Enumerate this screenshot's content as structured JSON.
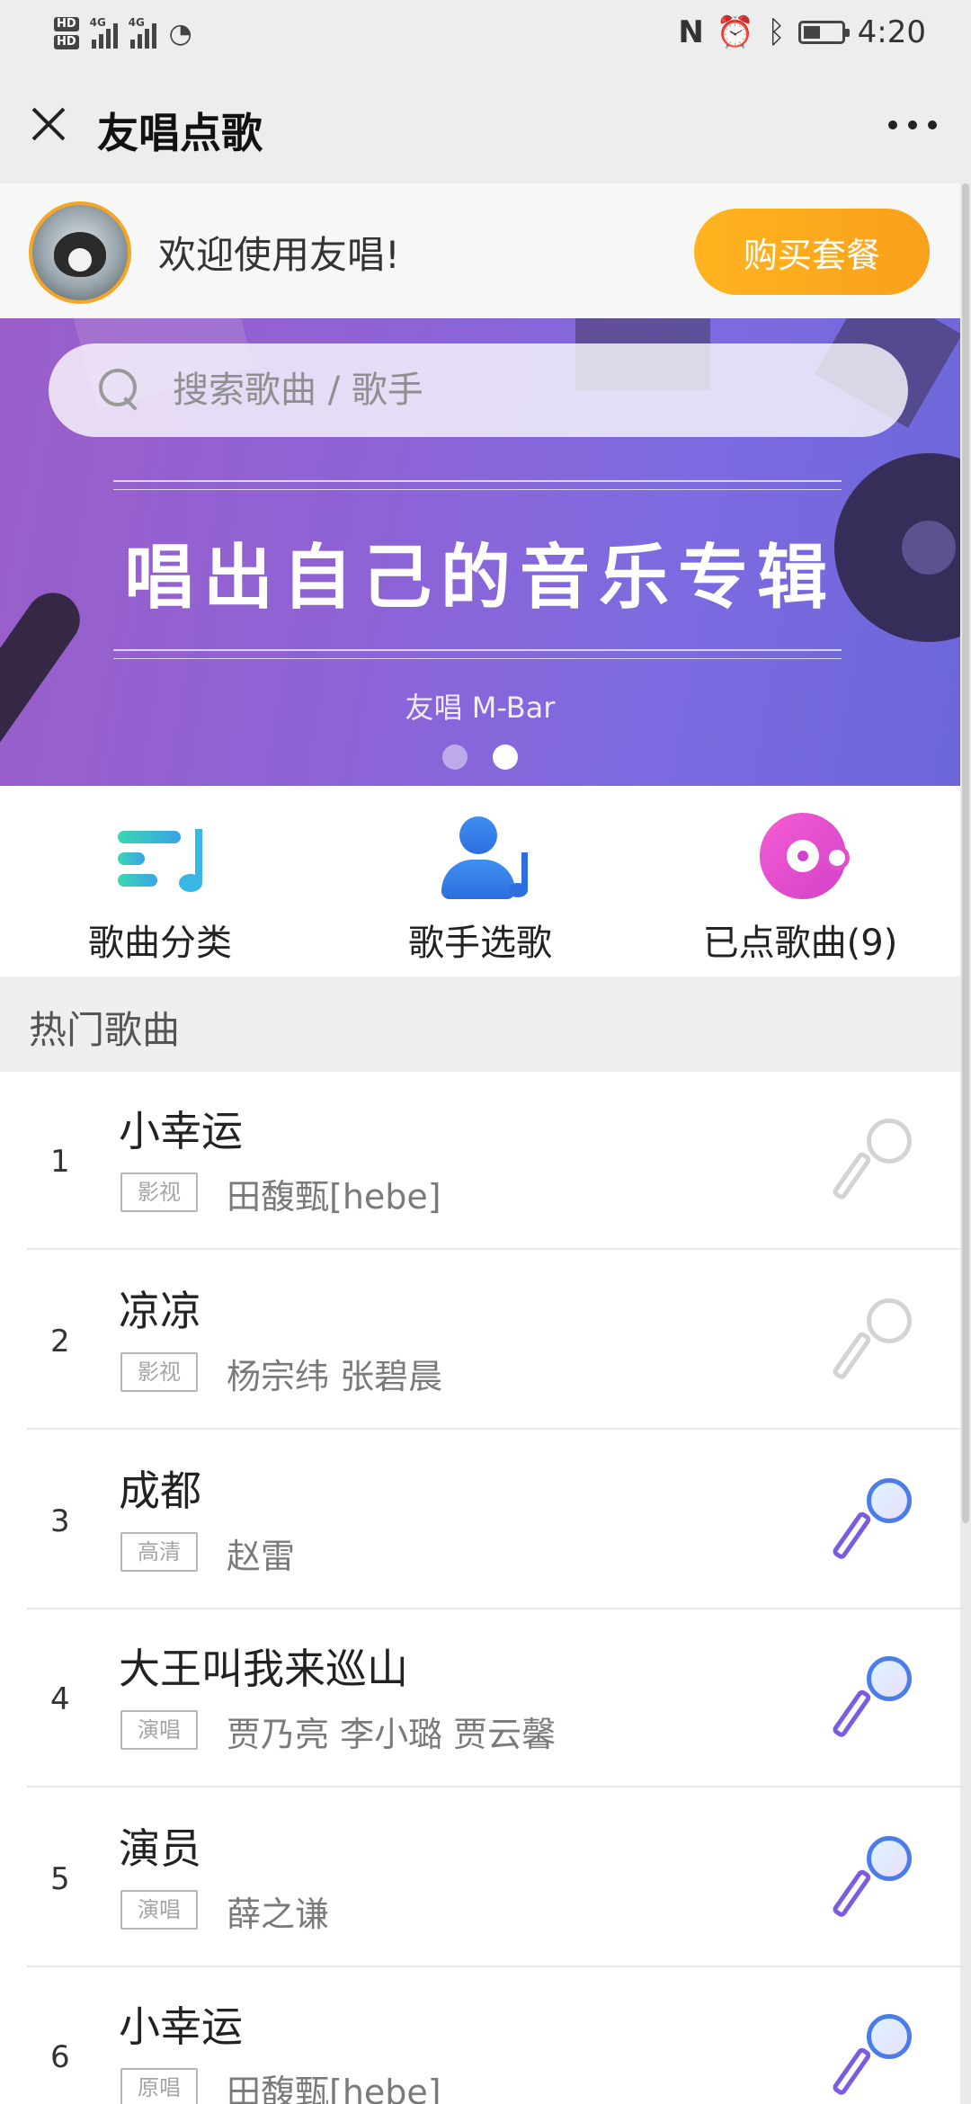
{
  "status_bar": {
    "hd1": "HD",
    "hd2": "HD",
    "net1": "4G",
    "net2": "4G",
    "time": "4:20",
    "icons": [
      "nfc-icon",
      "alarm-icon",
      "bluetooth-icon",
      "battery-icon"
    ]
  },
  "header": {
    "title": "友唱点歌",
    "close_icon": "close-icon",
    "more_icon": "more-icon"
  },
  "welcome": {
    "text": "欢迎使用友唱!",
    "buy_label": "购买套餐",
    "buy_color": "#f9a01b"
  },
  "banner": {
    "search_placeholder": "搜索歌曲 / 歌手",
    "title": "唱出自己的音乐专辑",
    "subtitle": "友唱 M-Bar",
    "slides": 2,
    "active_slide": 2
  },
  "categories": [
    {
      "label": "歌曲分类",
      "icon": "music-list-icon"
    },
    {
      "label": "歌手选歌",
      "icon": "singer-icon"
    },
    {
      "label": "已点歌曲(9)",
      "icon": "record-mic-icon"
    }
  ],
  "section": {
    "title": "热门歌曲"
  },
  "songs": [
    {
      "rank": "1",
      "title": "小幸运",
      "tag": "影视",
      "artist": "田馥甄[hebe]",
      "mic_state": "inactive"
    },
    {
      "rank": "2",
      "title": "凉凉",
      "tag": "影视",
      "artist": "杨宗纬 张碧晨",
      "mic_state": "inactive"
    },
    {
      "rank": "3",
      "title": "成都",
      "tag": "高清",
      "artist": "赵雷",
      "mic_state": "active"
    },
    {
      "rank": "4",
      "title": "大王叫我来巡山",
      "tag": "演唱",
      "artist": "贾乃亮 李小璐 贾云馨",
      "mic_state": "active"
    },
    {
      "rank": "5",
      "title": "演员",
      "tag": "演唱",
      "artist": "薛之谦",
      "mic_state": "active"
    },
    {
      "rank": "6",
      "title": "小幸运",
      "tag": "原唱",
      "artist": "田馥甄[hebe]",
      "mic_state": "active"
    }
  ]
}
